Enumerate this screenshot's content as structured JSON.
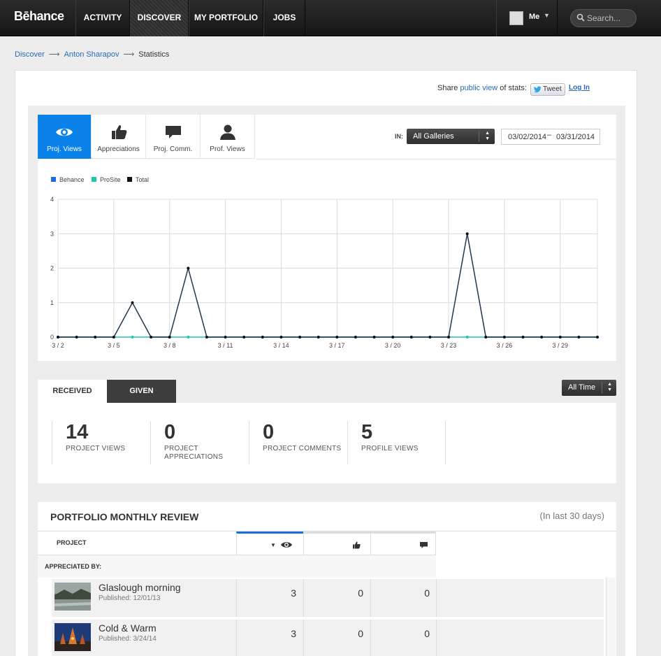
{
  "nav": {
    "logo": "Bēhance",
    "items": [
      "ACTIVITY",
      "DISCOVER",
      "MY PORTFOLIO",
      "JOBS"
    ],
    "active": "DISCOVER",
    "me_label": "Me",
    "search_placeholder": "Search..."
  },
  "breadcrumb": {
    "items": [
      "Discover",
      "Anton Sharapov",
      "Statistics"
    ]
  },
  "share": {
    "prefix": "Share",
    "link": "public view",
    "suffix": "of stats:",
    "tweet_label": "Tweet",
    "login_label": "Log In"
  },
  "stat_tabs": [
    {
      "label": "Proj. Views",
      "icon": "eye-icon"
    },
    {
      "label": "Appreciations",
      "icon": "thumbs-up-icon"
    },
    {
      "label": "Proj. Comm.",
      "icon": "comment-icon"
    },
    {
      "label": "Prof. Views",
      "icon": "person-icon"
    }
  ],
  "filters": {
    "in_label": "IN:",
    "gallery": "All Galleries",
    "date_from": "03/02/2014",
    "date_to": "03/31/2014",
    "time_range": "All Time"
  },
  "chart_data": {
    "type": "line",
    "legend_position": "top-left",
    "grid": true,
    "x": [
      "3/2",
      "3/3",
      "3/4",
      "3/5",
      "3/6",
      "3/7",
      "3/8",
      "3/9",
      "3/10",
      "3/11",
      "3/12",
      "3/13",
      "3/14",
      "3/15",
      "3/16",
      "3/17",
      "3/18",
      "3/19",
      "3/20",
      "3/21",
      "3/22",
      "3/23",
      "3/24",
      "3/25",
      "3/26",
      "3/27",
      "3/28",
      "3/29",
      "3/30",
      "3/31"
    ],
    "x_tick_labels": [
      "3 / 2",
      "3 / 5",
      "3 / 8",
      "3 / 11",
      "3 / 14",
      "3 / 17",
      "3 / 20",
      "3 / 23",
      "3 / 26",
      "3 / 29"
    ],
    "y_ticks": [
      0,
      1,
      2,
      3,
      4
    ],
    "ylim": [
      0,
      4
    ],
    "series": [
      {
        "name": "Behance",
        "color": "#1a6de0",
        "values": [
          0,
          0,
          0,
          0,
          1,
          0,
          0,
          2,
          0,
          0,
          0,
          0,
          0,
          0,
          0,
          0,
          0,
          0,
          0,
          0,
          0,
          0,
          3,
          0,
          0,
          0,
          0,
          0,
          0,
          0
        ]
      },
      {
        "name": "ProSite",
        "color": "#1ec9a8",
        "values": [
          0,
          0,
          0,
          0,
          0,
          0,
          0,
          0,
          0,
          0,
          0,
          0,
          0,
          0,
          0,
          0,
          0,
          0,
          0,
          0,
          0,
          0,
          0,
          0,
          0,
          0,
          0,
          0,
          0,
          0
        ]
      },
      {
        "name": "Total",
        "color": "#111111",
        "values": [
          0,
          0,
          0,
          0,
          1,
          0,
          0,
          2,
          0,
          0,
          0,
          0,
          0,
          0,
          0,
          0,
          0,
          0,
          0,
          0,
          0,
          0,
          3,
          0,
          0,
          0,
          0,
          0,
          0,
          0
        ]
      }
    ]
  },
  "summary": {
    "tab_received": "RECEIVED",
    "tab_given": "GIVEN",
    "stats": [
      {
        "value": "14",
        "label": "PROJECT VIEWS"
      },
      {
        "value": "0",
        "label": "PROJECT APPRECIATIONS"
      },
      {
        "value": "0",
        "label": "PROJECT COMMENTS"
      },
      {
        "value": "5",
        "label": "PROFILE VIEWS"
      }
    ]
  },
  "review": {
    "title": "PORTFOLIO MONTHLY REVIEW",
    "note": "(In last 30 days)",
    "col_project": "PROJECT",
    "appreciated_by": "APPRECIATED BY:",
    "rows": [
      {
        "name": "Glaslough morning",
        "published": "Published: 12/01/13",
        "views": "3",
        "appreciations": "0",
        "comments": "0"
      },
      {
        "name": "Cold & Warm",
        "published": "Published: 3/24/14",
        "views": "3",
        "appreciations": "0",
        "comments": "0"
      }
    ]
  }
}
